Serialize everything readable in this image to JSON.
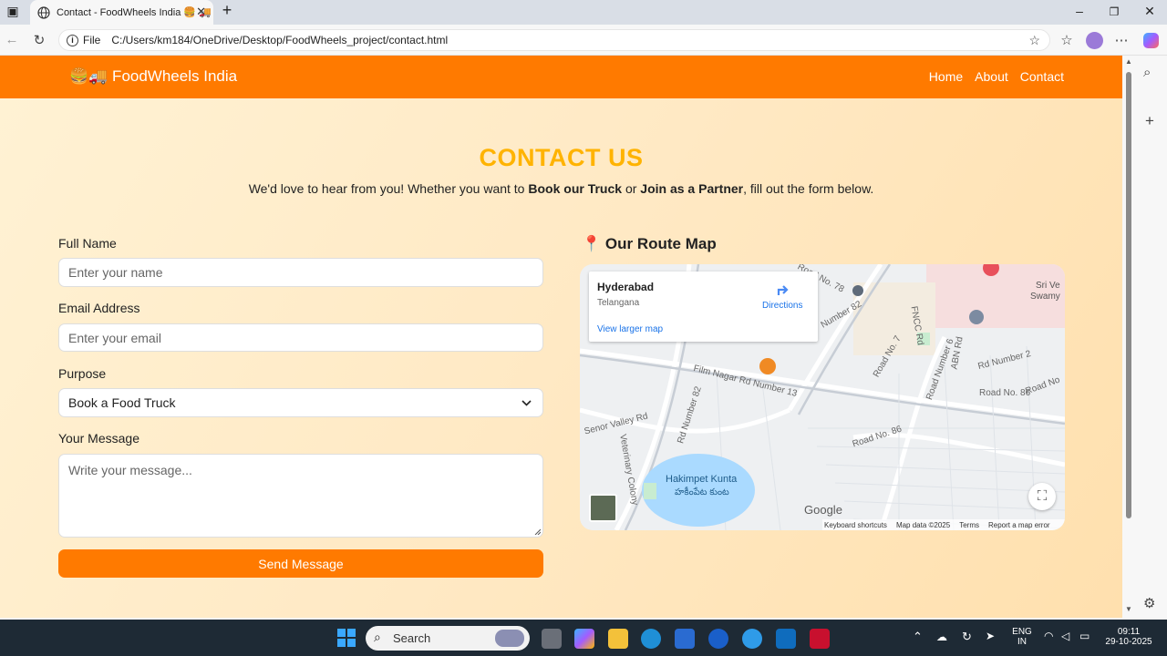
{
  "browser": {
    "tab_title": "Contact - FoodWheels India 🍔 🚚",
    "tab_close": "✕",
    "new_tab": "+",
    "address_prefix": "File",
    "url": "C:/Users/km184/OneDrive/Desktop/FoodWheels_project/contact.html"
  },
  "nav": {
    "brand": "🍔🚚 FoodWheels India",
    "links": [
      "Home",
      "About",
      "Contact"
    ]
  },
  "header": {
    "title": "CONTACT US",
    "subtitle_1": "We'd love to hear from you! Whether you want to ",
    "subtitle_b1": "Book our Truck",
    "subtitle_2": " or ",
    "subtitle_b2": "Join as a Partner",
    "subtitle_3": ", fill out the form below."
  },
  "form": {
    "name_label": "Full Name",
    "name_placeholder": "Enter your name",
    "email_label": "Email Address",
    "email_placeholder": "Enter your email",
    "purpose_label": "Purpose",
    "purpose_value": "Book a Food Truck",
    "message_label": "Your Message",
    "message_placeholder": "Write your message...",
    "submit": "Send Message"
  },
  "map": {
    "title": "📍 Our Route Map",
    "place": "Hyderabad",
    "region": "Telangana",
    "directions": "Directions",
    "larger_map": "View larger map",
    "labels": [
      "Film Nagar Rd Number 13",
      "Road No. 86",
      "Road No. 86",
      "Senor Valley Rd",
      "Rd Number 82",
      "Number 82",
      "Road No. 78",
      "Road No. 7",
      "Road Number 6",
      "Rd Number 2",
      "Road No",
      "ABN Rd",
      "Veterinary Colony",
      "FNCC Rd",
      "Sri Ve",
      "Swamy"
    ],
    "lake": "Hakimpet Kunta",
    "lake_te": "హకీంపేట కుంట",
    "google": "Google",
    "footer": [
      "Keyboard shortcuts",
      "Map data ©2025",
      "Terms",
      "Report a map error"
    ]
  },
  "taskbar": {
    "search": "Search",
    "lang": "ENG",
    "region": "IN",
    "time": "09:11",
    "date": "29-10-2025"
  }
}
